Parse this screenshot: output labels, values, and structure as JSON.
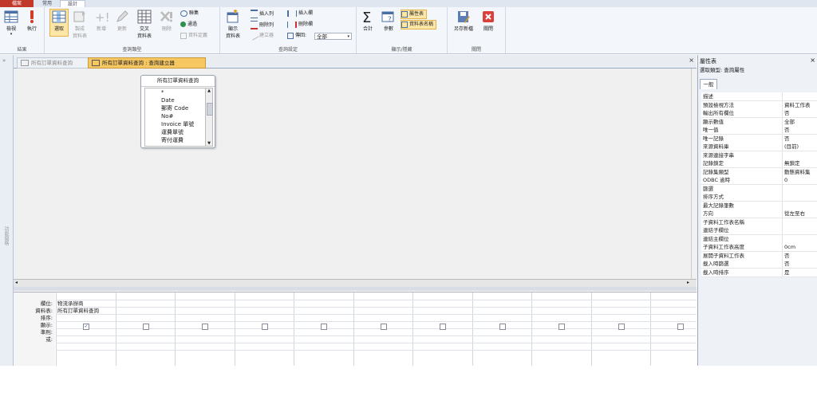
{
  "tabs": {
    "file": "檔案",
    "home": "常用",
    "design": "設計"
  },
  "ribbon": {
    "results": {
      "label": "結果",
      "view": "檢視",
      "run": "執行"
    },
    "query_type": {
      "label": "查詢類型",
      "select": "選取",
      "make_table_1": "製成",
      "make_table_2": "資料表",
      "append": "新增",
      "update": "更新",
      "crosstab_1": "交叉",
      "crosstab_2": "資料表",
      "delete": "刪除",
      "union": "聯集",
      "pass_through": "通過",
      "data_definition": "資料定義"
    },
    "query_setup": {
      "label": "查詢設定",
      "show_table_1": "顯示",
      "show_table_2": "資料表",
      "insert_rows": "插入列",
      "delete_rows": "刪除列",
      "builder": "建立器",
      "insert_columns": "插入欄",
      "delete_columns": "刪除欄",
      "return_label": "傳回:",
      "return_value": "全部"
    },
    "show_hide": {
      "label": "顯示/隱藏",
      "totals": "合計",
      "parameters": "參數",
      "property_sheet": "屬性表",
      "table_names": "資料表名稱"
    },
    "close": {
      "label": "關閉",
      "save_as": "另存新檔",
      "close": "關閉"
    }
  },
  "nav_pane": {
    "label": "功能窗格"
  },
  "doc_tabs": [
    {
      "label": "所有訂單資料查詢"
    },
    {
      "label": "所有訂單資料查詢 : 查詢建立器"
    }
  ],
  "table_box": {
    "title": "所有訂單資料查詢",
    "fields": [
      "*",
      "Date",
      "郵寄 Code",
      "No#",
      "Invoice 單號",
      "運費單號",
      "寄付運費"
    ]
  },
  "grid": {
    "row_labels": [
      "欄位:",
      "資料表:",
      "排序:",
      "顯示:",
      "準則:",
      "或:"
    ],
    "first_column": {
      "field": "物流承辦商",
      "table": "所有訂單資料查詢",
      "show_checked": "✓"
    }
  },
  "property_sheet": {
    "title": "屬性表",
    "selection_type_label": "選取類型:",
    "selection_type_value": "查詢屬性",
    "tab": "一般",
    "rows": [
      {
        "name": "描述",
        "value": ""
      },
      {
        "name": "預設檢視方法",
        "value": "資料工作表"
      },
      {
        "name": "輸出所有欄位",
        "value": "否"
      },
      {
        "name": "顯示數值",
        "value": "全部"
      },
      {
        "name": "唯一值",
        "value": "否"
      },
      {
        "name": "唯一記錄",
        "value": "否"
      },
      {
        "name": "來源資料庫",
        "value": "(目前)"
      },
      {
        "name": "來源連接字串",
        "value": ""
      },
      {
        "name": "記錄鎖定",
        "value": "無鎖定"
      },
      {
        "name": "記錄集類型",
        "value": "動態資料集"
      },
      {
        "name": "ODBC 逾時",
        "value": "0"
      },
      {
        "name": "篩選",
        "value": ""
      },
      {
        "name": "排序方式",
        "value": ""
      },
      {
        "name": "最大記錄筆數",
        "value": ""
      },
      {
        "name": "方向",
        "value": "從左至右"
      },
      {
        "name": "子資料工作表名稱",
        "value": ""
      },
      {
        "name": "連結子欄位",
        "value": ""
      },
      {
        "name": "連結主欄位",
        "value": ""
      },
      {
        "name": "子資料工作表高度",
        "value": "0cm"
      },
      {
        "name": "展開子資料工作表",
        "value": "否"
      },
      {
        "name": "載入時篩選",
        "value": "否"
      },
      {
        "name": "載入時排序",
        "value": "是"
      }
    ]
  },
  "colors": {
    "accent_file": "#c0392b",
    "active_tab": "#f7c762",
    "selected_button": "#fde7a8"
  }
}
